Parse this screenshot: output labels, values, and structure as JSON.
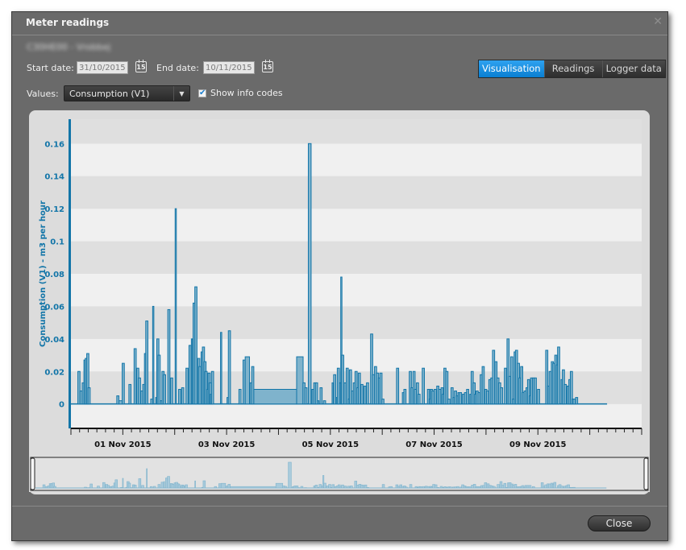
{
  "window": {
    "title": "Meter readings",
    "close_icon": "close-x-icon",
    "meter_name": "C30HE00 - Vrobbej"
  },
  "filters": {
    "start_label": "Start date:",
    "start_value": "31/10/2015",
    "end_label": "End date:",
    "end_value": "10/11/2015",
    "calendar_icon_text": "15",
    "values_label": "Values:",
    "values_selected": "Consumption (V1)",
    "show_info_codes_label": "Show info codes",
    "show_info_codes_checked": true
  },
  "tabs": [
    {
      "label": "Visualisation",
      "active": true
    },
    {
      "label": "Readings",
      "active": false
    },
    {
      "label": "Logger data",
      "active": false
    }
  ],
  "footer": {
    "close_label": "Close"
  },
  "colors": {
    "accent": "#0a7fd2",
    "series": "#1275a8",
    "series_fill": "#7fb3cc"
  },
  "chart_data": {
    "type": "bar",
    "title": "",
    "xlabel": "",
    "ylabel": "Consumption (V1) - m3 per hour",
    "ylim": [
      -0.015,
      0.175
    ],
    "yticks": [
      0,
      0.02,
      0.04,
      0.06,
      0.08,
      0.1,
      0.12,
      0.14,
      0.16
    ],
    "ytick_labels": [
      "0",
      "0.02",
      "0.04",
      "0.06",
      "0.08",
      "0.1",
      "0.12",
      "0.14",
      "0.16"
    ],
    "x_unit": "hours since 31 Oct 2015 00:00",
    "xlim_hours": [
      0,
      264
    ],
    "xtick_labels": [
      {
        "label": "01 Nov 2015",
        "hour": 24
      },
      {
        "label": "03 Nov 2015",
        "hour": 72
      },
      {
        "label": "05 Nov 2015",
        "hour": 120
      },
      {
        "label": "07 Nov 2015",
        "hour": 168
      },
      {
        "label": "09 Nov 2015",
        "hour": 216
      }
    ],
    "grid": true,
    "legend": "none",
    "bars": [
      [
        3.2,
        1,
        0.02
      ],
      [
        4.2,
        1,
        0.008
      ],
      [
        5.2,
        1,
        0.013
      ],
      [
        6.0,
        1,
        0.027
      ],
      [
        6.6,
        1,
        0.028
      ],
      [
        7.3,
        1,
        0.031
      ],
      [
        7.9,
        1,
        0.01
      ],
      [
        21.2,
        1,
        0.005
      ],
      [
        22.2,
        1.5,
        0.002
      ],
      [
        23.7,
        1,
        0.025
      ],
      [
        26.8,
        1,
        0.012
      ],
      [
        29.2,
        1,
        0.034
      ],
      [
        30.4,
        1,
        0.022
      ],
      [
        31.2,
        1,
        0.016
      ],
      [
        32.3,
        1,
        0.008
      ],
      [
        33.2,
        1,
        0.012
      ],
      [
        34.0,
        1,
        0.031
      ],
      [
        34.6,
        1,
        0.051
      ],
      [
        36.9,
        1,
        0.003
      ],
      [
        37.8,
        0.3,
        0.06
      ],
      [
        39.2,
        1,
        0.004
      ],
      [
        39.7,
        1,
        0.04
      ],
      [
        40.3,
        1,
        0.03
      ],
      [
        41.3,
        1,
        0.002
      ],
      [
        42.1,
        1,
        0.02
      ],
      [
        42.8,
        1,
        0.018
      ],
      [
        44.8,
        1,
        0.058
      ],
      [
        46.1,
        1,
        0.016
      ],
      [
        48.2,
        0.3,
        0.12
      ],
      [
        49.8,
        1,
        0.009
      ],
      [
        51.2,
        1,
        0.01
      ],
      [
        53.2,
        1,
        0.022
      ],
      [
        54.6,
        1,
        0.036
      ],
      [
        55.7,
        0.4,
        0.04
      ],
      [
        56.5,
        1,
        0.062
      ],
      [
        57.3,
        1,
        0.072
      ],
      [
        58.6,
        1,
        0.028
      ],
      [
        59.2,
        1,
        0.023
      ],
      [
        60.2,
        1,
        0.032
      ],
      [
        60.8,
        1,
        0.035
      ],
      [
        61.5,
        1,
        0.026
      ],
      [
        62.0,
        1,
        0.02
      ],
      [
        62.8,
        1,
        0.009
      ],
      [
        63.4,
        1,
        0.019
      ],
      [
        64.0,
        1,
        0.013
      ],
      [
        64.5,
        1,
        0.006
      ],
      [
        65.0,
        1,
        0.02
      ],
      [
        69.2,
        0.3,
        0.044
      ],
      [
        72.2,
        1,
        0.004
      ],
      [
        72.8,
        1,
        0.045
      ],
      [
        77.7,
        1,
        0.009
      ],
      [
        79.6,
        1,
        0.027
      ],
      [
        80.6,
        2,
        0.029
      ],
      [
        82.8,
        1,
        0.013
      ],
      [
        83.6,
        1,
        0.023
      ],
      [
        84.6,
        20,
        0.009
      ],
      [
        104.4,
        3,
        0.029
      ],
      [
        107.3,
        1,
        0.013
      ],
      [
        108.2,
        1,
        0.01
      ],
      [
        109.8,
        1.3,
        0.16
      ],
      [
        111.5,
        1,
        0.009
      ],
      [
        112.3,
        1,
        0.013
      ],
      [
        113.1,
        1,
        0.013
      ],
      [
        114.0,
        0.7,
        0.002
      ],
      [
        115.2,
        1,
        0.01
      ],
      [
        116.8,
        1,
        0.002
      ],
      [
        120.8,
        0.5,
        0.013
      ],
      [
        121.5,
        1,
        0.018
      ],
      [
        122.7,
        1,
        0.004
      ],
      [
        123.2,
        1,
        0.022
      ],
      [
        124.2,
        1,
        0.013
      ],
      [
        124.8,
        0.5,
        0.078
      ],
      [
        125.2,
        1,
        0.03
      ],
      [
        126.3,
        1,
        0.013
      ],
      [
        127.3,
        1,
        0.022
      ],
      [
        128.2,
        1,
        0.003
      ],
      [
        128.8,
        1,
        0.021
      ],
      [
        129.8,
        1,
        0.008
      ],
      [
        130.6,
        1,
        0.013
      ],
      [
        131.4,
        1,
        0.02
      ],
      [
        132.2,
        1,
        0.01
      ],
      [
        132.9,
        1,
        0.019
      ],
      [
        134.1,
        1,
        0.012
      ],
      [
        135.5,
        1,
        0.011
      ],
      [
        136.7,
        1,
        0.013
      ],
      [
        138.6,
        1,
        0.043
      ],
      [
        139.5,
        1,
        0.018
      ],
      [
        140.4,
        1,
        0.023
      ],
      [
        141.3,
        1,
        0.019
      ],
      [
        142.2,
        1,
        0.016
      ],
      [
        142.9,
        1,
        0.019
      ],
      [
        143.8,
        1,
        0.003
      ],
      [
        150.6,
        1,
        0.022
      ],
      [
        153.3,
        1,
        0.007
      ],
      [
        154.0,
        1,
        0.009
      ],
      [
        156.5,
        1,
        0.02
      ],
      [
        157.3,
        1,
        0.01
      ],
      [
        158.2,
        1,
        0.02
      ],
      [
        158.9,
        1,
        0.009
      ],
      [
        159.8,
        1,
        0.013
      ],
      [
        160.5,
        1,
        0.006
      ],
      [
        162.5,
        1,
        0.022
      ],
      [
        164.9,
        1,
        0.009
      ],
      [
        165.7,
        1,
        0.003
      ],
      [
        166.3,
        1,
        0.009
      ],
      [
        167.0,
        1,
        0.008
      ],
      [
        168.0,
        1,
        0.009
      ],
      [
        169.2,
        1,
        0.011
      ],
      [
        170.1,
        1,
        0.009
      ],
      [
        171.2,
        1,
        0.01
      ],
      [
        171.8,
        1,
        0.006
      ],
      [
        172.5,
        1,
        0.022
      ],
      [
        173.4,
        1,
        0.02
      ],
      [
        174.3,
        1,
        0.003
      ],
      [
        175.8,
        1,
        0.01
      ],
      [
        176.7,
        1,
        0.004
      ],
      [
        177.4,
        1,
        0.008
      ],
      [
        178.3,
        1,
        0.005
      ],
      [
        179.0,
        1,
        0.007
      ],
      [
        179.7,
        1,
        0.007
      ],
      [
        181.1,
        1,
        0.006
      ],
      [
        182.0,
        1,
        0.007
      ],
      [
        183.0,
        1,
        0.009
      ],
      [
        184.5,
        1,
        0.006
      ],
      [
        185.1,
        1,
        0.02
      ],
      [
        186.0,
        1,
        0.013
      ],
      [
        186.7,
        1,
        0.006
      ],
      [
        187.4,
        1,
        0.008
      ],
      [
        188.3,
        1,
        0.007
      ],
      [
        189.3,
        1,
        0.018
      ],
      [
        190.2,
        1,
        0.023
      ],
      [
        191.4,
        1,
        0.009
      ],
      [
        192.2,
        1,
        0.008
      ],
      [
        193.3,
        1,
        0.015
      ],
      [
        194.2,
        1,
        0.016
      ],
      [
        195.0,
        1,
        0.033
      ],
      [
        196.1,
        1,
        0.026
      ],
      [
        197.0,
        1,
        0.016
      ],
      [
        197.8,
        1,
        0.013
      ],
      [
        198.7,
        1,
        0.01
      ],
      [
        200.5,
        1,
        0.022
      ],
      [
        201.7,
        1,
        0.04
      ],
      [
        202.5,
        1,
        0.017
      ],
      [
        203.4,
        1,
        0.029
      ],
      [
        204.2,
        1,
        0.003
      ],
      [
        205.0,
        1,
        0.032
      ],
      [
        205.6,
        1,
        0.033
      ],
      [
        206.5,
        1,
        0.025
      ],
      [
        207.2,
        1,
        0.016
      ],
      [
        208.0,
        1,
        0.023
      ],
      [
        208.8,
        1,
        0.007
      ],
      [
        209.6,
        1,
        0.008
      ],
      [
        210.5,
        1,
        0.01
      ],
      [
        211.2,
        1,
        0.015
      ],
      [
        212.0,
        1,
        0.005
      ],
      [
        212.6,
        1,
        0.016
      ],
      [
        213.5,
        1,
        0.016
      ],
      [
        214.3,
        1,
        0.016
      ],
      [
        215.8,
        1,
        0.009
      ],
      [
        219.6,
        1,
        0.033
      ],
      [
        220.5,
        1,
        0.011
      ],
      [
        221.2,
        1,
        0.02
      ],
      [
        222.2,
        1,
        0.026
      ],
      [
        222.9,
        1,
        0.025
      ],
      [
        223.8,
        1,
        0.03
      ],
      [
        224.5,
        1,
        0.024
      ],
      [
        225.1,
        1,
        0.035
      ],
      [
        226.7,
        1,
        0.015
      ],
      [
        227.3,
        1,
        0.021
      ],
      [
        228.2,
        1,
        0.012
      ],
      [
        229.5,
        1,
        0.011
      ],
      [
        230.3,
        1,
        0.015
      ],
      [
        231.0,
        1,
        0.02
      ],
      [
        231.8,
        1,
        0.003
      ],
      [
        232.3,
        1,
        0.003
      ],
      [
        233.4,
        1,
        0.004
      ]
    ],
    "baseline_end_hour": 248
  }
}
